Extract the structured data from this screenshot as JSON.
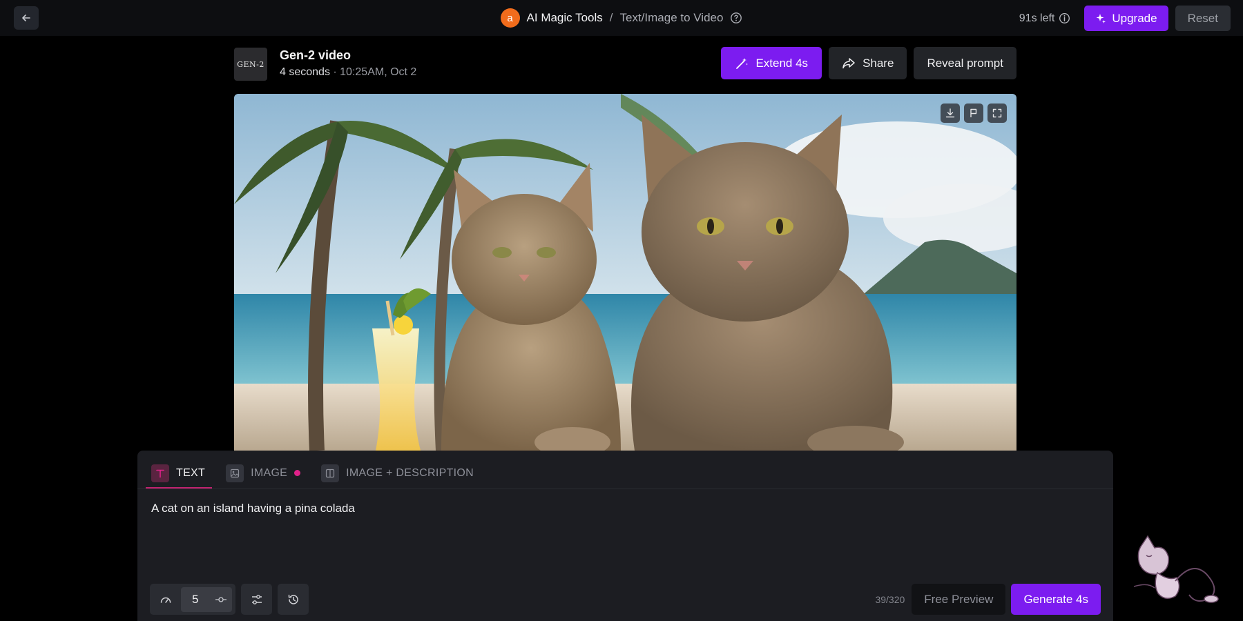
{
  "topbar": {
    "brand_initial": "a",
    "brand_name": "AI Magic Tools",
    "separator": "/",
    "page_name": "Text/Image to Video",
    "time_left": "91s left",
    "upgrade_label": "Upgrade",
    "reset_label": "Reset",
    "icons": {
      "back": "arrow-left-icon",
      "help": "question-circle-icon",
      "info": "info-circle-icon",
      "upgrade": "sparkle-icon"
    }
  },
  "video": {
    "logo_text": "GEN-2",
    "title": "Gen-2 video",
    "duration": "4 seconds",
    "meta_sep": " · ",
    "timestamp": "10:25AM, Oct 2",
    "extend_label": "Extend 4s",
    "share_label": "Share",
    "reveal_label": "Reveal prompt",
    "controls": [
      "download-icon",
      "flag-icon",
      "fullscreen-icon"
    ]
  },
  "panel": {
    "tabs": [
      {
        "label": "TEXT",
        "active": true
      },
      {
        "label": "IMAGE",
        "active": false
      },
      {
        "label": "IMAGE + DESCRIPTION",
        "active": false
      }
    ],
    "prompt_value": "A cat on an island having a pina colada",
    "seed_value": "5",
    "char_count": "39/320",
    "free_preview_label": "Free Preview",
    "generate_label": "Generate 4s"
  },
  "colors": {
    "accent": "#7c1cf0",
    "tab_underline": "#c2226f",
    "brand": "#f16c1c",
    "dot": "#e0218a"
  }
}
